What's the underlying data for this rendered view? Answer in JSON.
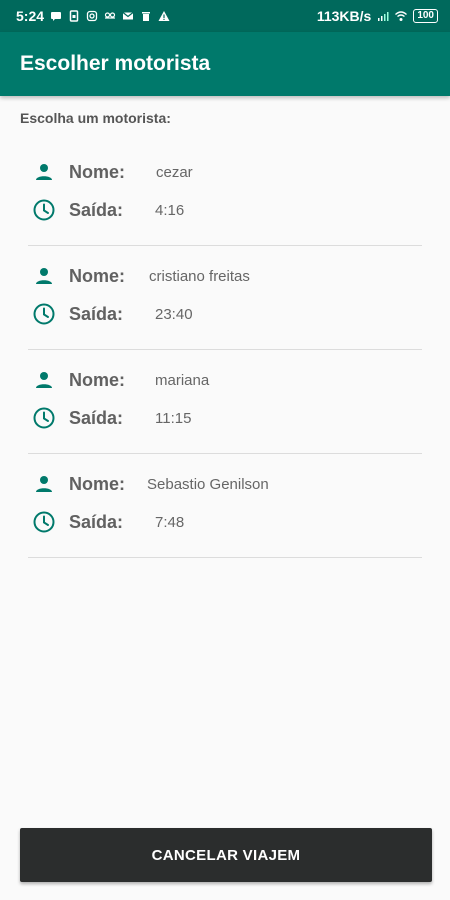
{
  "status_bar": {
    "time": "5:24",
    "network_speed": "113KB/s",
    "battery": "100",
    "left_icons": [
      "message-icon",
      "sim-icon",
      "instagram-icon",
      "db-icon",
      "mail-icon",
      "trash-icon",
      "warning-icon"
    ],
    "right_icons": [
      "signal-icon",
      "wifi-icon",
      "battery-icon"
    ]
  },
  "app_bar": {
    "title": "Escolher motorista"
  },
  "subtitle": "Escolha um motorista:",
  "labels": {
    "name": "Nome:",
    "departure": "Saída:"
  },
  "drivers": [
    {
      "name": "cezar",
      "departure": "4:16"
    },
    {
      "name": "cristiano freitas",
      "departure": "23:40"
    },
    {
      "name": "mariana",
      "departure": "11:15"
    },
    {
      "name": "Sebastio Genilson",
      "departure": "7:48"
    }
  ],
  "cancel_button": {
    "label": "CANCELAR VIAJEM"
  },
  "colors": {
    "primary": "#00796b",
    "primary_dark": "#00695c",
    "icon": "#00796b",
    "button": "#2b2d2d"
  }
}
